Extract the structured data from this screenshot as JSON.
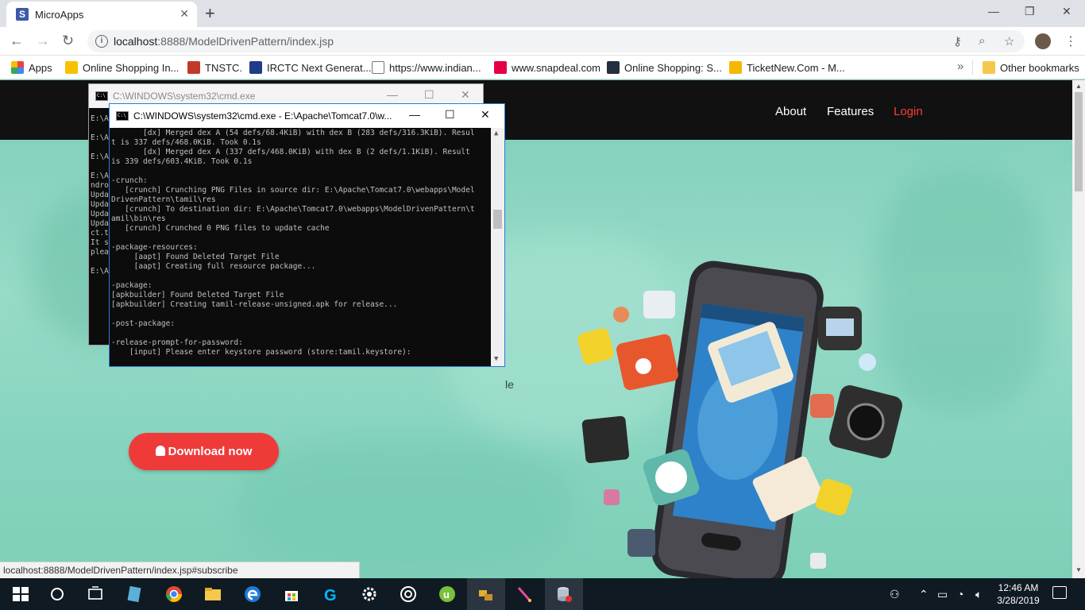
{
  "browser": {
    "tab_title": "MicroApps",
    "tab_favicon_letter": "S",
    "url_host": "localhost",
    "url_rest": ":8888/ModelDrivenPattern/index.jsp",
    "bookmarks": [
      {
        "label": "Apps",
        "color": "#e8453c"
      },
      {
        "label": "Online Shopping In...",
        "color": "#f7c200"
      },
      {
        "label": "TNSTC.",
        "color": "#c0392b"
      },
      {
        "label": "IRCTC Next Generat...",
        "color": "#1f3c88"
      },
      {
        "label": "https://www.indian...",
        "color": "#9e9e9e"
      },
      {
        "label": "www.snapdeal.com",
        "color": "#e40046"
      },
      {
        "label": "Online Shopping: S...",
        "color": "#232f3e"
      },
      {
        "label": "TicketNew.Com - M...",
        "color": "#f5b800"
      }
    ],
    "other_bookmarks": "Other bookmarks"
  },
  "site": {
    "nav": [
      "About",
      "Features",
      "Login"
    ],
    "download_label": "Download now",
    "hero_fragment": "le",
    "status_url": "localhost:8888/ModelDrivenPattern/index.jsp#subscribe"
  },
  "cmd_back": {
    "title": "C:\\WINDOWS\\system32\\cmd.exe",
    "lines": "E:\\A\n\nE:\\A\n\nE:\\A\n\nE:\\A\nndro\nUpda\nUpda\nUpda\nUpda\nct.t\nIt s\nplea\n\nE:\\A"
  },
  "cmd_front": {
    "title": "C:\\WINDOWS\\system32\\cmd.exe - E:\\Apache\\Tomcat7.0\\w...",
    "lines": "       [dx] Merged dex A (54 defs/68.4KiB) with dex B (283 defs/316.3KiB). Resul\nt is 337 defs/468.0KiB. Took 0.1s\n       [dx] Merged dex A (337 defs/468.0KiB) with dex B (2 defs/1.1KiB). Result\nis 339 defs/603.4KiB. Took 0.1s\n\n-crunch:\n   [crunch] Crunching PNG Files in source dir: E:\\Apache\\Tomcat7.0\\webapps\\Model\nDrivenPattern\\tamil\\res\n   [crunch] To destination dir: E:\\Apache\\Tomcat7.0\\webapps\\ModelDrivenPattern\\t\namil\\bin\\res\n   [crunch] Crunched 0 PNG files to update cache\n\n-package-resources:\n     [aapt] Found Deleted Target File\n     [aapt] Creating full resource package...\n\n-package:\n[apkbuilder] Found Deleted Target File\n[apkbuilder] Creating tamil-release-unsigned.apk for release...\n\n-post-package:\n\n-release-prompt-for-password:\n    [input] Please enter keystore password (store:tamil.keystore):"
  },
  "taskbar": {
    "time": "12:46 AM",
    "date": "3/28/2019"
  }
}
